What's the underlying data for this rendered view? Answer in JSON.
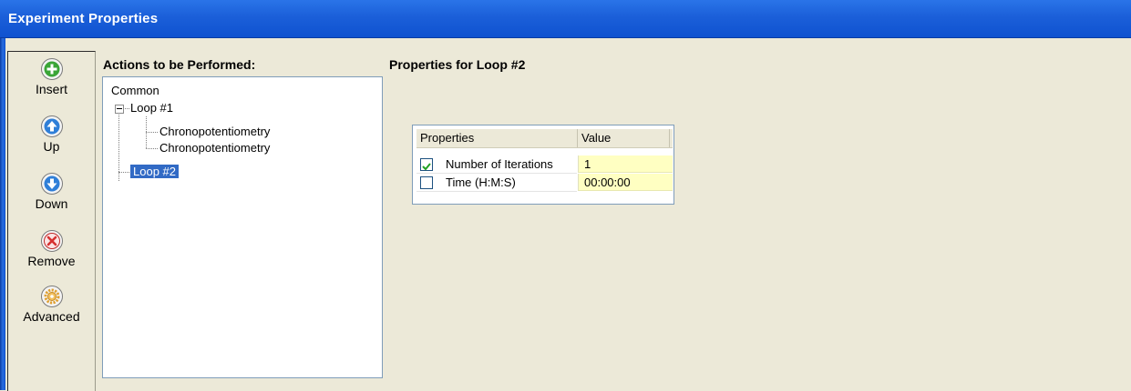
{
  "window": {
    "title": "Experiment Properties"
  },
  "toolbar": {
    "buttons": [
      {
        "label": "Insert",
        "icon": "plus-icon",
        "color": "#3aa537"
      },
      {
        "label": "Up",
        "icon": "arrow-up-icon",
        "color": "#2f7fd8"
      },
      {
        "label": "Down",
        "icon": "arrow-down-icon",
        "color": "#2f7fd8"
      },
      {
        "label": "Remove",
        "icon": "remove-x-icon",
        "color": "#d64040"
      },
      {
        "label": "Advanced",
        "icon": "gear-icon",
        "color": "#e0a030"
      }
    ]
  },
  "actions": {
    "heading": "Actions to be Performed:",
    "tree": [
      {
        "label": "Common"
      },
      {
        "label": "Loop #1",
        "expanded": true
      },
      {
        "label": "Chronopotentiometry"
      },
      {
        "label": "Chronopotentiometry"
      },
      {
        "label": "Loop #2",
        "selected": true
      }
    ]
  },
  "properties": {
    "heading": "Properties for Loop #2",
    "columns": [
      "Properties",
      "Value"
    ],
    "rows": [
      {
        "name": "Number of Iterations",
        "value": "1",
        "checked": true
      },
      {
        "name": "Time (H:M:S)",
        "value": "00:00:00",
        "checked": false
      }
    ]
  }
}
